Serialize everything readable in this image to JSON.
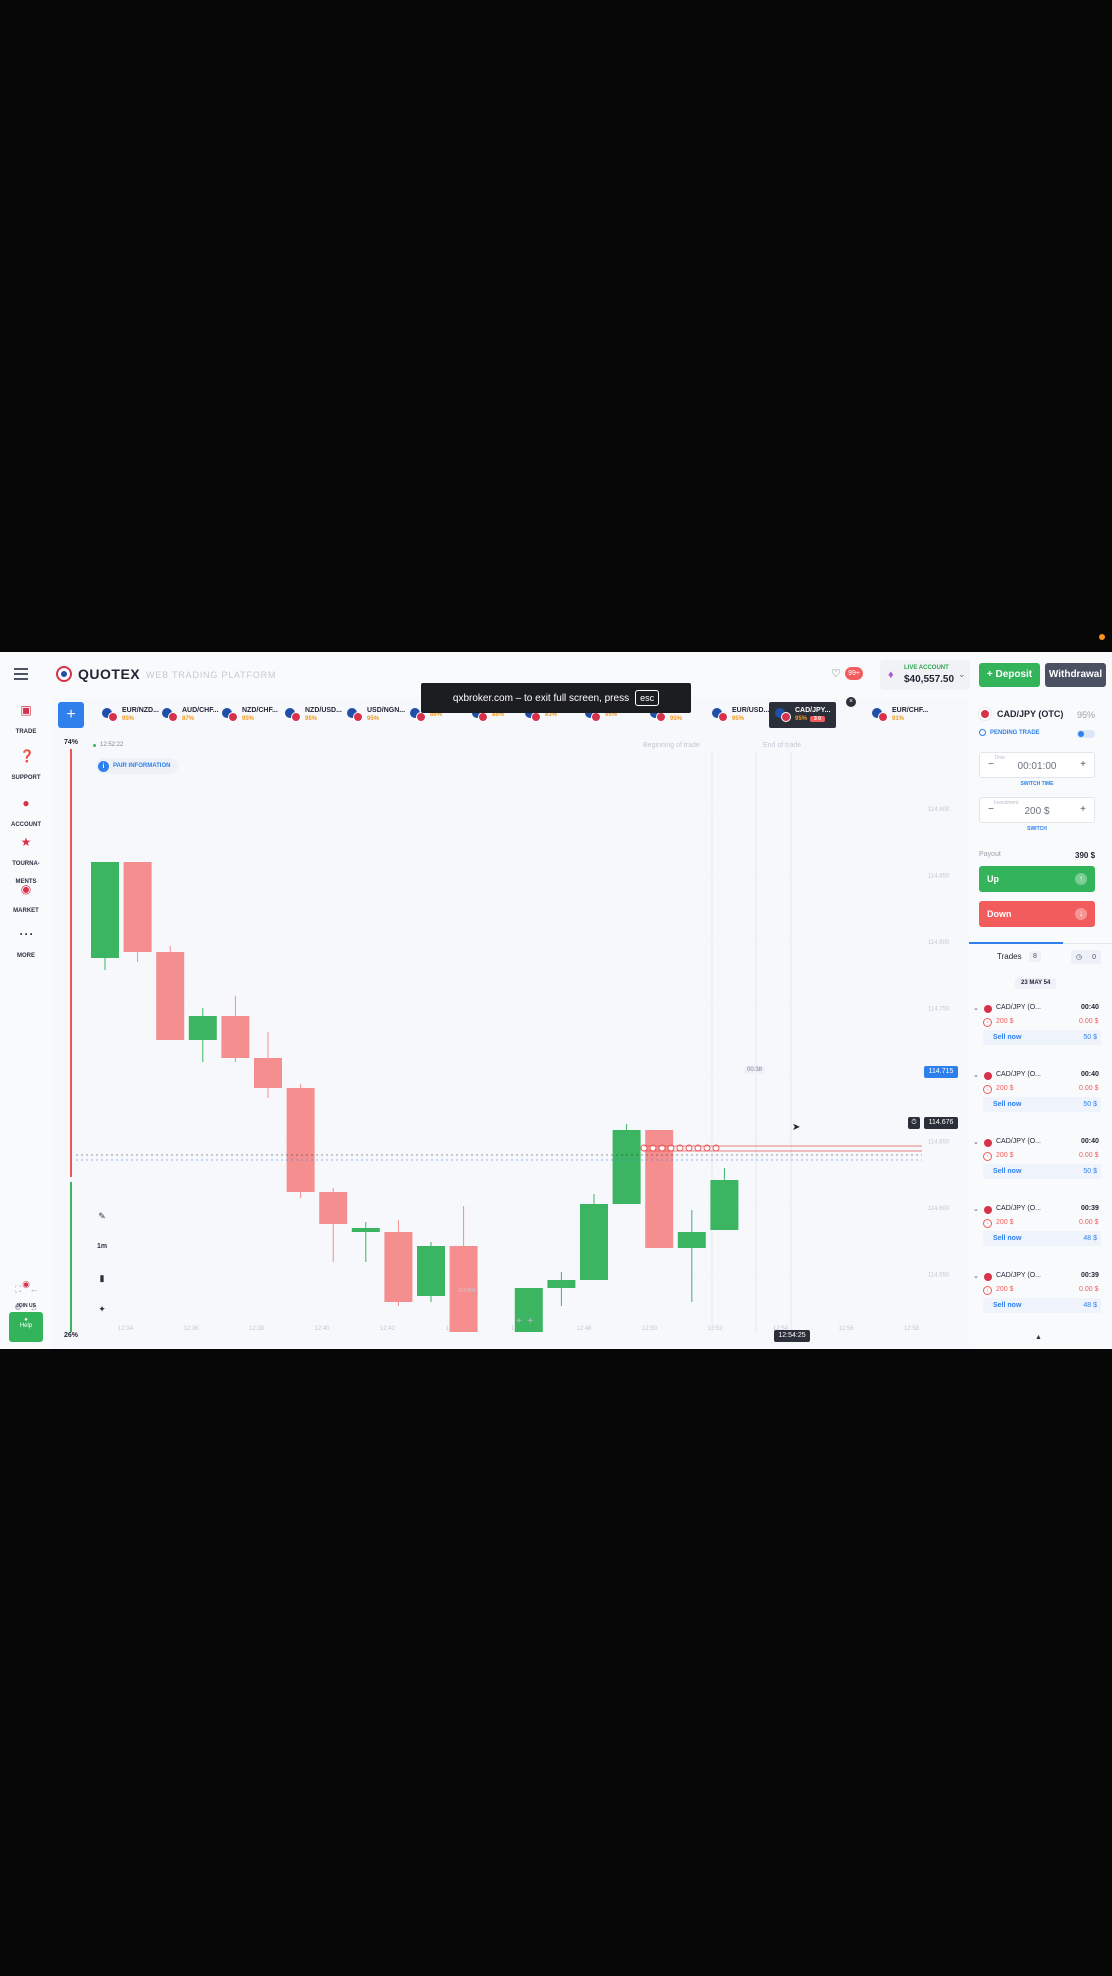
{
  "header": {
    "brand": "QUOTEX",
    "platform_label": "WEB TRADING PLATFORM",
    "notifications_badge": "99+",
    "account_type": "LIVE ACCOUNT",
    "account_balance": "$40,557.50",
    "deposit_label": "Deposit",
    "withdraw_label": "Withdrawal"
  },
  "fullscreen_toast": {
    "message": "qxbroker.com – to exit full screen, press",
    "key": "esc"
  },
  "nav": {
    "trade": "TRADE",
    "support": "SUPPORT",
    "account": "ACCOUNT",
    "tournaments_1": "TOURNA-",
    "tournaments_2": "MENTS",
    "market": "MARKET",
    "more": "MORE",
    "join_us": "JOIN US",
    "help": "Help",
    "tournaments_badge": "4",
    "market_badge": "4"
  },
  "asset_tabs": [
    {
      "name": "EUR/NZD...",
      "pct": "95%"
    },
    {
      "name": "AUD/CHF...",
      "pct": "87%"
    },
    {
      "name": "NZD/CHF...",
      "pct": "95%"
    },
    {
      "name": "NZD/USD...",
      "pct": "95%"
    },
    {
      "name": "USD/NGN...",
      "pct": "95%"
    },
    {
      "name": "",
      "pct": "86%"
    },
    {
      "name": "",
      "pct": "88%"
    },
    {
      "name": "",
      "pct": "83%"
    },
    {
      "name": "",
      "pct": "95%"
    },
    {
      "name": "ZAR...",
      "pct": "95%"
    },
    {
      "name": "EUR/USD...",
      "pct": "95%"
    },
    {
      "name": "CAD/JPY...",
      "pct": "95%",
      "timer": "3 0"
    },
    {
      "name": "EUR/CHF...",
      "pct": "91%"
    }
  ],
  "chart": {
    "sentiment_top": "74%",
    "sentiment_bottom": "26%",
    "time": "12:52:22",
    "pair_info": "PAIR INFORMATION",
    "beginning_label": "Beginning of trade",
    "end_label": "End of trade",
    "current_price": "114.715",
    "trade_price": "114.676",
    "countdown": "00:38",
    "current_time": "12:54:25",
    "timeframe": "1m",
    "y_ticks": [
      "114.800",
      "114.850",
      "114.800",
      "114.750",
      "114.700",
      "114.650",
      "114.600",
      "114.550"
    ],
    "x_ticks": [
      "12:34",
      "12:36",
      "12:38",
      "12:40",
      "12:42",
      "12:44",
      "12:46",
      "12:48",
      "12:50",
      "12:52",
      "12:54",
      "12:56",
      "12:58"
    ],
    "low_label": "114.584"
  },
  "chart_data": {
    "type": "candlestick",
    "ylim": [
      114.545,
      114.845
    ],
    "candles": [
      {
        "o": 114.732,
        "c": 114.78,
        "h": 114.78,
        "l": 114.726
      },
      {
        "o": 114.78,
        "c": 114.735,
        "h": 114.78,
        "l": 114.73
      },
      {
        "o": 114.735,
        "c": 114.691,
        "h": 114.738,
        "l": 114.691
      },
      {
        "o": 114.691,
        "c": 114.703,
        "h": 114.707,
        "l": 114.68
      },
      {
        "o": 114.703,
        "c": 114.682,
        "h": 114.713,
        "l": 114.68
      },
      {
        "o": 114.682,
        "c": 114.667,
        "h": 114.695,
        "l": 114.662
      },
      {
        "o": 114.667,
        "c": 114.615,
        "h": 114.669,
        "l": 114.612
      },
      {
        "o": 114.615,
        "c": 114.599,
        "h": 114.617,
        "l": 114.58
      },
      {
        "o": 114.595,
        "c": 114.597,
        "h": 114.6,
        "l": 114.58
      },
      {
        "o": 114.595,
        "c": 114.56,
        "h": 114.601,
        "l": 114.558
      },
      {
        "o": 114.563,
        "c": 114.588,
        "h": 114.59,
        "l": 114.56
      },
      {
        "o": 114.588,
        "c": 114.525,
        "h": 114.608,
        "l": 114.525
      },
      {
        "o": 114.525,
        "c": 114.536,
        "h": 114.545,
        "l": 114.514
      },
      {
        "o": 114.536,
        "c": 114.567,
        "h": 114.567,
        "l": 114.536
      },
      {
        "o": 114.567,
        "c": 114.571,
        "h": 114.575,
        "l": 114.558
      },
      {
        "o": 114.571,
        "c": 114.609,
        "h": 114.614,
        "l": 114.571
      },
      {
        "o": 114.609,
        "c": 114.646,
        "h": 114.649,
        "l": 114.609
      },
      {
        "o": 114.646,
        "c": 114.587,
        "h": 114.646,
        "l": 114.587
      },
      {
        "o": 114.587,
        "c": 114.595,
        "h": 114.606,
        "l": 114.56
      },
      {
        "o": 114.596,
        "c": 114.621,
        "h": 114.627,
        "l": 114.596
      }
    ]
  },
  "panel": {
    "asset": "CAD/JPY (OTC)",
    "asset_pct": "95%",
    "pending": "PENDING TRADE",
    "time_caption": "Time",
    "time_value": "00:01:00",
    "switch_time": "SWITCH TIME",
    "amount_caption": "Investment",
    "amount_value": "200 $",
    "switch": "SWITCH",
    "payout_label": "Payout",
    "payout_value": "390 $",
    "up": "Up",
    "down": "Down",
    "trades_tab": "Trades",
    "trades_count": "8",
    "clock_count": "0",
    "date": "23 MAY  54"
  },
  "trades": [
    {
      "asset": "CAD/JPY (O...",
      "time": "00:40",
      "amount": "200 $",
      "profit": "0.00 $",
      "sell_label": "Sell now",
      "sell_value": "50 $"
    },
    {
      "asset": "CAD/JPY (O...",
      "time": "00:40",
      "amount": "200 $",
      "profit": "0.00 $",
      "sell_label": "Sell now",
      "sell_value": "50 $"
    },
    {
      "asset": "CAD/JPY (O...",
      "time": "00:40",
      "amount": "200 $",
      "profit": "0.00 $",
      "sell_label": "Sell now",
      "sell_value": "50 $"
    },
    {
      "asset": "CAD/JPY (O...",
      "time": "00:39",
      "amount": "200 $",
      "profit": "0.00 $",
      "sell_label": "Sell now",
      "sell_value": "48 $"
    },
    {
      "asset": "CAD/JPY (O...",
      "time": "00:39",
      "amount": "200 $",
      "profit": "0.00 $",
      "sell_label": "Sell now",
      "sell_value": "48 $"
    }
  ],
  "colors": {
    "up": "#3cb563",
    "down": "#f58f8f",
    "accent": "#2f80ed"
  }
}
